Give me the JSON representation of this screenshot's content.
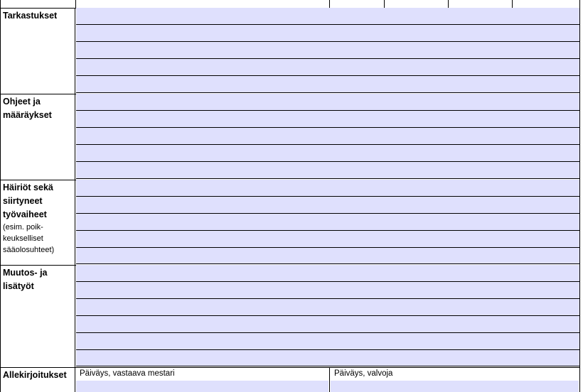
{
  "sections": [
    {
      "label": "Tarkastukset",
      "note": "",
      "rows": 5
    },
    {
      "label": "Ohjeet ja\nmääräykset",
      "note": "",
      "rows": 5
    },
    {
      "label": "Häiriöt sekä\nsiirtyneet\ntyövaiheet",
      "note": "(esim. poik-\nkeukselliset\nsääolosuhteet)",
      "rows": 5
    },
    {
      "label": "Muutos- ja\nlisätyöt",
      "note": "",
      "rows": 6
    }
  ],
  "signatures": {
    "label": "Allekirjoitukset",
    "left_caption": "Päiväys, vastaava mestari",
    "right_caption": "Päiväys, valvoja"
  },
  "colors": {
    "field_fill": "#dfe0fd",
    "border": "#000000"
  }
}
